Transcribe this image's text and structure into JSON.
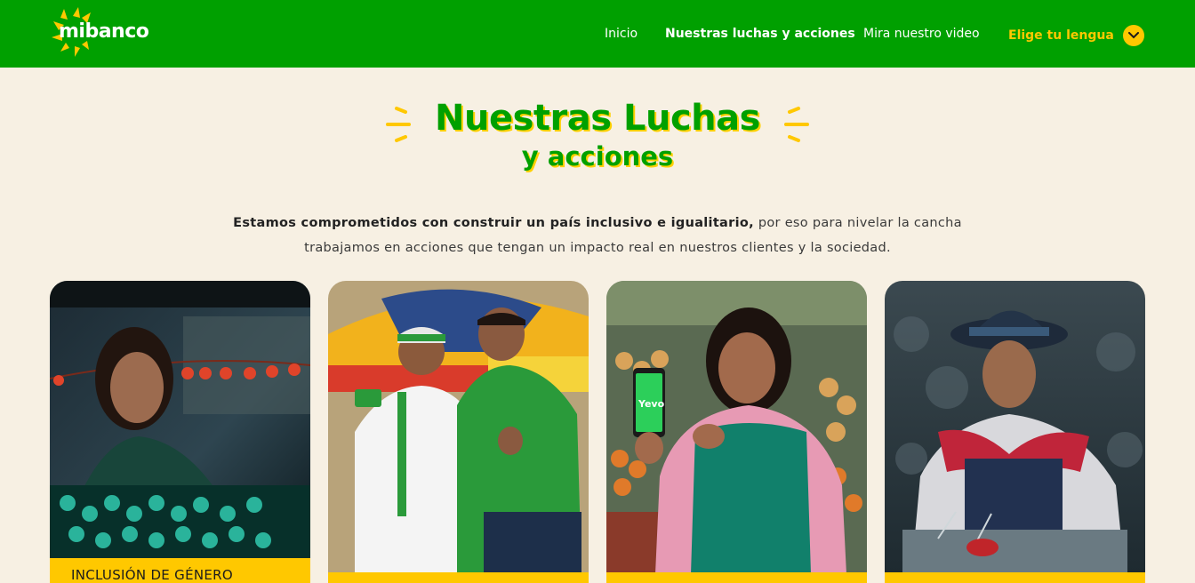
{
  "nav": {
    "logo_text": "mibanco",
    "links": [
      "Inicio",
      "Nuestras luchas y acciones",
      "Mira nuestro video"
    ],
    "language_label": "Elige tu lengua"
  },
  "heading": {
    "line1": "Nuestras Luchas",
    "line2": "y acciones"
  },
  "intro": {
    "bold": "Estamos comprometidos con construir un país inclusivo e igualitario,",
    "rest_line1": " por eso para nivelar la cancha",
    "line2": "trabajamos en acciones que tengan un impacto real en nuestros clientes y la sociedad."
  },
  "cards": [
    {
      "label": "INCLUSIÓN DE GÉNERO"
    },
    {
      "label": ""
    },
    {
      "label": "",
      "phone_text": "Yevo"
    },
    {
      "label": ""
    }
  ],
  "colors": {
    "brand_green": "#00a000",
    "accent_yellow": "#ffc800",
    "background": "#f7f0e3"
  }
}
